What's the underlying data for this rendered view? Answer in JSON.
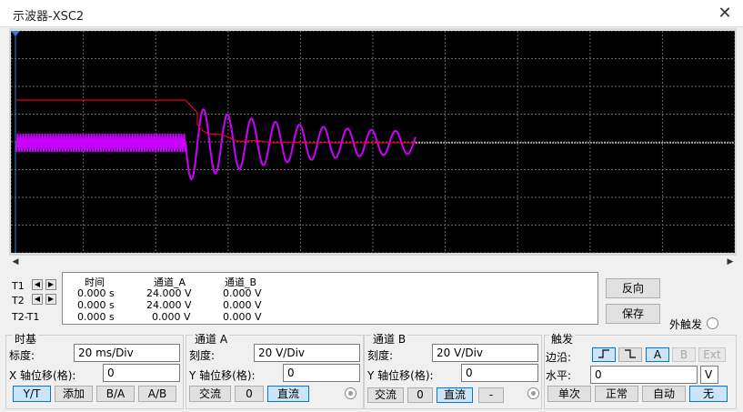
{
  "window": {
    "title": "示波器-XSC2",
    "close_glyph": "✕"
  },
  "colors": {
    "trace_a": "#cc00ff",
    "trace_b": "#e8001c",
    "grid": "#6a6a6a",
    "screen_bg": "#000000"
  },
  "readout": {
    "headers": {
      "time": "时间",
      "ch_a": "通道_A",
      "ch_b": "通道_B"
    },
    "rows": [
      {
        "label": "T1",
        "time": "0.000 s",
        "ch_a": "24.000 V",
        "ch_b": "0.000 V"
      },
      {
        "label": "T2",
        "time": "0.000 s",
        "ch_a": "24.000 V",
        "ch_b": "0.000 V"
      },
      {
        "label": "T2-T1",
        "time": "0.000 s",
        "ch_a": "0.000 V",
        "ch_b": "0.000 V"
      }
    ]
  },
  "buttons": {
    "reverse": "反向",
    "save": "保存"
  },
  "ext_trigger": {
    "label": "外触发"
  },
  "timebase": {
    "title": "时基",
    "scale_label": "标度:",
    "scale_value": "20 ms/Div",
    "xpos_label": "X 轴位移(格):",
    "xpos_value": "0",
    "modes": [
      "Y/T",
      "添加",
      "B/A",
      "A/B"
    ]
  },
  "channel_a": {
    "title": "通道 A",
    "scale_label": "刻度:",
    "scale_value": "20  V/Div",
    "ypos_label": "Y 轴位移(格):",
    "ypos_value": "0",
    "coupling": [
      "交流",
      "0",
      "直流"
    ]
  },
  "channel_b": {
    "title": "通道 B",
    "scale_label": "刻度:",
    "scale_value": "20  V/Div",
    "ypos_label": "Y 轴位移(格):",
    "ypos_value": "0",
    "coupling": [
      "交流",
      "0",
      "直流",
      "-"
    ]
  },
  "trigger": {
    "title": "触发",
    "edge_label": "边沿:",
    "level_label": "水平:",
    "level_value": "0",
    "level_unit": "V",
    "sources": [
      "A",
      "B",
      "Ext"
    ],
    "modes": [
      "单次",
      "正常",
      "自动",
      "无"
    ]
  }
}
